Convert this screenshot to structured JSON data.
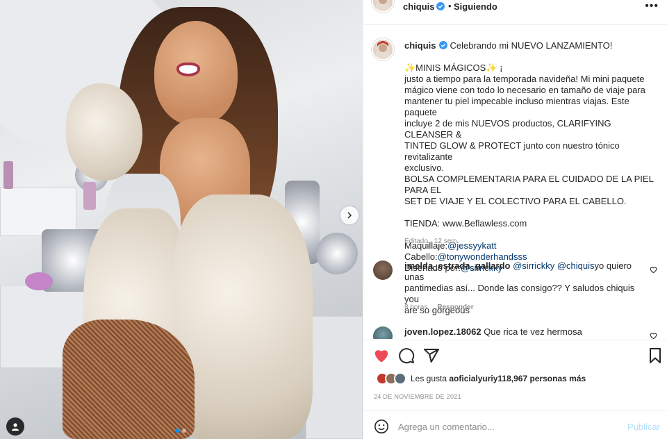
{
  "post": {
    "media_alt": "",
    "carousel": {
      "dots": 2,
      "active": 0
    }
  },
  "header": {
    "username": "chiquis",
    "separator": "•",
    "follow_status": "Siguiendo",
    "more": "•••"
  },
  "caption": {
    "username": "chiquis",
    "lines": [
      {
        "parts": [
          {
            "t": "Celebrando mi NUEVO LANZAMIENTO!"
          }
        ]
      },
      {
        "blank": true
      },
      {
        "parts": [
          {
            "t": "✨MINIS MÁGICOS✨ ¡"
          }
        ]
      },
      {
        "parts": [
          {
            "t": "justo a tiempo para la temporada navideña! Mi mini paquete"
          }
        ]
      },
      {
        "parts": [
          {
            "t": "mágico viene con todo lo necesario en tamaño de viaje para"
          }
        ]
      },
      {
        "parts": [
          {
            "t": "mantener tu piel impecable incluso mientras viajas. Este paquete"
          }
        ]
      },
      {
        "parts": [
          {
            "t": "incluye 2 de mis NUEVOS productos, CLARIFYING CLEANSER &"
          }
        ]
      },
      {
        "parts": [
          {
            "t": "TINTED GLOW & PROTECT junto con nuestro tónico revitalizante"
          }
        ]
      },
      {
        "parts": [
          {
            "t": "exclusivo."
          }
        ]
      },
      {
        "parts": [
          {
            "t": "BOLSA COMPLEMENTARIA PARA EL CUIDADO DE LA PIEL PARA EL"
          }
        ]
      },
      {
        "parts": [
          {
            "t": "SET DE VIAJE Y EL COLECTIVO PARA EL CABELLO."
          }
        ]
      },
      {
        "blank": true
      },
      {
        "parts": [
          {
            "t": "TIENDA: www.Beflawless.com"
          }
        ]
      },
      {
        "blank": true
      },
      {
        "parts": [
          {
            "t": "Maquillaje:"
          },
          {
            "t": "@jessyykatt",
            "mention": true
          }
        ]
      },
      {
        "parts": [
          {
            "t": "Cabello:"
          },
          {
            "t": "@tonywonderhandsss",
            "mention": true
          }
        ]
      },
      {
        "parts": [
          {
            "t": "Diseñado por:"
          },
          {
            "t": "@sirrickky",
            "mention": true
          }
        ]
      }
    ],
    "meta": "Editado · 12 sem"
  },
  "comments": [
    {
      "username": "imelda_estrada_gallardo",
      "mention1": "@sirrickky",
      "mention2": "@chiquis",
      "text_line1_rest": "yo quiero unas",
      "text_line2": "pantimedias así... Donde las consigo?? Y saludos chiquis you",
      "text_line3": "are so gorgeous",
      "time": "8 horas",
      "reply": "Responder"
    },
    {
      "username": "joven.lopez.18062",
      "text": "Que rica te vez hermosa"
    }
  ],
  "likes": {
    "prefix": "Les gusta ",
    "user": "aoficialyuriy",
    "count": "118,967 personas más"
  },
  "date": "24 DE NOVIEMBRE DE 2021",
  "composer": {
    "placeholder": "Agrega un comentario...",
    "publish": "Publicar"
  },
  "colors": {
    "accent": "#0095f6",
    "like_red": "#ed4956",
    "mention": "#00376b",
    "publish_disabled": "#b2dffc",
    "verified": "#3897f0"
  }
}
